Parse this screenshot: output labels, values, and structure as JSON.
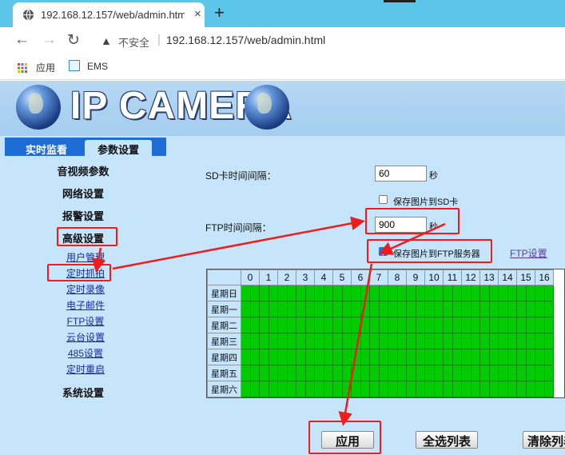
{
  "browser": {
    "tab_title": "192.168.12.157/web/admin.htm",
    "tab_close": "×",
    "new_tab": "+",
    "nav_back": "←",
    "nav_forward": "→",
    "nav_reload": "↻",
    "security_icon": "▲",
    "insecure_label": "不安全",
    "separator": "|",
    "url": "192.168.12.157/web/admin.html",
    "bookmarks": [
      {
        "label": "应用",
        "icon": "apps-grid-icon"
      },
      {
        "label": "EMS",
        "icon": "ems-icon"
      }
    ]
  },
  "header": {
    "logo_text": "IP CAMERA",
    "logo_icon": "globe-icon"
  },
  "tabs": [
    {
      "label": "实时监看",
      "active": false
    },
    {
      "label": "参数设置",
      "active": true
    }
  ],
  "sidebar": {
    "sections": [
      "音视频参数",
      "网络设置",
      "报警设置",
      "高级设置",
      "系统设置"
    ],
    "advanced_items": [
      "用户管理",
      "定时抓拍",
      "定时录像",
      "电子邮件",
      "FTP设置",
      "云台设置",
      "485设置",
      "定时重启"
    ]
  },
  "form": {
    "sd_interval_label": "SD卡时间间隔：",
    "sd_interval_value": "60",
    "sd_unit": "秒",
    "save_sd_label": "保存图片到SD卡",
    "save_sd_checked": false,
    "ftp_interval_label": "FTP时间间隔：",
    "ftp_interval_value": "900",
    "ftp_unit": "秒",
    "save_ftp_label": "保存图片到FTP服务器",
    "save_ftp_checked": true,
    "ftp_settings_link": "FTP设置"
  },
  "schedule": {
    "hours": [
      "0",
      "1",
      "2",
      "3",
      "4",
      "5",
      "6",
      "7",
      "8",
      "9",
      "10",
      "11",
      "12",
      "13",
      "14",
      "15",
      "16"
    ],
    "days": [
      "星期日",
      "星期一",
      "星期二",
      "星期三",
      "星期四",
      "星期五",
      "星期六"
    ],
    "slot_color": "#00cc00"
  },
  "buttons": {
    "apply": "应用",
    "select_all": "全选列表",
    "clear": "清除列表"
  },
  "colors": {
    "page_bg": "#c6e4fa",
    "tab_active_bg": "#1e6cd6",
    "annotation": "#ee1c1c",
    "chrome_bg": "#5cc5ea"
  }
}
